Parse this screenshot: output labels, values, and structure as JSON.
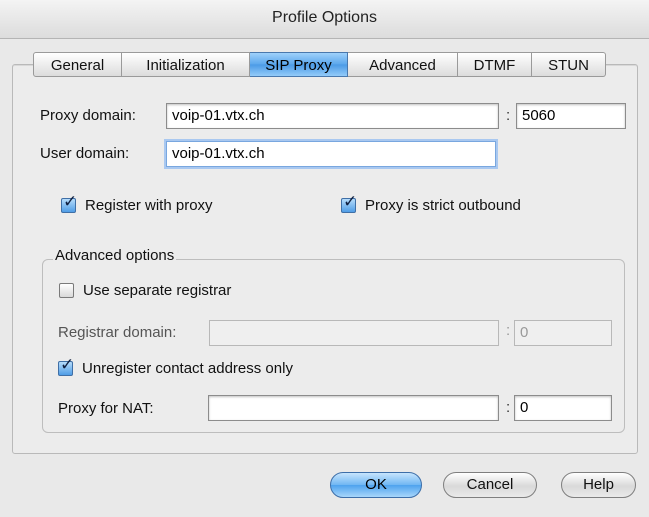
{
  "window": {
    "title": "Profile Options"
  },
  "tabs": [
    {
      "label": "General",
      "active": false
    },
    {
      "label": "Initialization",
      "active": false
    },
    {
      "label": "SIP Proxy",
      "active": true
    },
    {
      "label": "Advanced",
      "active": false
    },
    {
      "label": "DTMF",
      "active": false
    },
    {
      "label": "STUN",
      "active": false
    }
  ],
  "sip_proxy": {
    "proxy_domain_label": "Proxy domain:",
    "proxy_domain_value": "voip-01.vtx.ch",
    "proxy_port": "5060",
    "user_domain_label": "User domain:",
    "user_domain_value": "voip-01.vtx.ch",
    "register_with_proxy": {
      "label": "Register with proxy",
      "checked": true
    },
    "proxy_strict_outbound": {
      "label": "Proxy is strict outbound",
      "checked": true
    }
  },
  "advanced_options": {
    "group_title": "Advanced options",
    "use_separate_registrar": {
      "label": "Use separate registrar",
      "checked": false
    },
    "registrar_domain_label": "Registrar domain:",
    "registrar_domain_value": "",
    "registrar_port": "0",
    "unregister_contact_only": {
      "label": "Unregister contact address only",
      "checked": true
    },
    "proxy_for_nat_label": "Proxy for NAT:",
    "proxy_for_nat_value": "",
    "nat_port": "0",
    "colon": ":"
  },
  "buttons": {
    "ok": "OK",
    "cancel": "Cancel",
    "help": "Help"
  },
  "colors": {
    "accent": "#4b9ae6",
    "window_bg": "#e9e9e9"
  }
}
